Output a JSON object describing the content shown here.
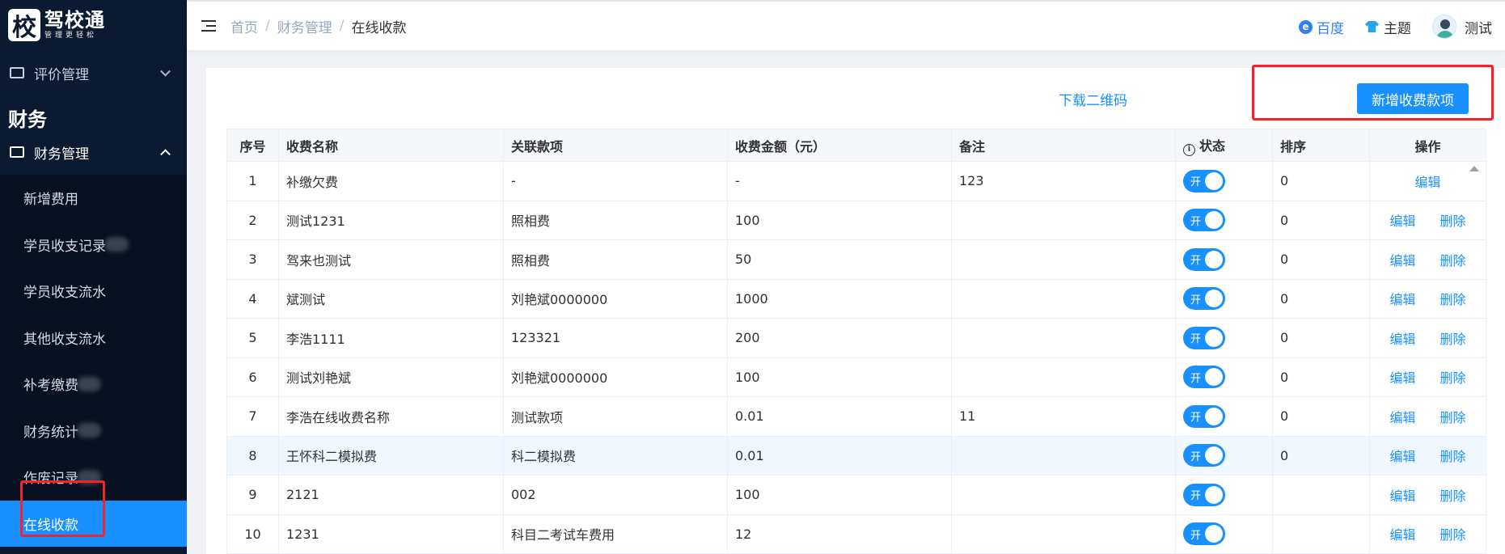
{
  "logo": {
    "mark": "校",
    "name": "驾校通",
    "slogan": "管理更轻松"
  },
  "sidebar": {
    "review_label": "评价管理",
    "section_title": "财务",
    "finance_label": "财务管理",
    "items": [
      {
        "label": "新增费用"
      },
      {
        "label": "学员收支记录"
      },
      {
        "label": "学员收支流水"
      },
      {
        "label": "其他收支流水"
      },
      {
        "label": "补考缴费"
      },
      {
        "label": "财务统计"
      },
      {
        "label": "作废记录"
      },
      {
        "label": "在线收款"
      }
    ]
  },
  "breadcrumb": {
    "home": "首页",
    "parent": "财务管理",
    "current": "在线收款",
    "sep": "/"
  },
  "header": {
    "baidu_icon": "e",
    "baidu": "百度",
    "theme": "主题",
    "user": "测试"
  },
  "actions": {
    "download_qr": "下载二维码",
    "add_item": "新增收费款项"
  },
  "table": {
    "columns": [
      "序号",
      "收费名称",
      "关联款项",
      "收费金额（元）",
      "备注",
      "状态",
      "排序",
      "操作"
    ],
    "status_info_icon": "i",
    "switch_label": "开",
    "edit_label": "编辑",
    "delete_label": "删除",
    "rows": [
      {
        "no": "1",
        "name": "补缴欠费",
        "linked": "-",
        "amount": "-",
        "remark": "123",
        "sort": "0"
      },
      {
        "no": "2",
        "name": "测试1231",
        "linked": "照相费",
        "amount": "100",
        "remark": "",
        "sort": "0"
      },
      {
        "no": "3",
        "name": "驾来也测试",
        "linked": "照相费",
        "amount": "50",
        "remark": "",
        "sort": "0"
      },
      {
        "no": "4",
        "name": "斌测试",
        "linked": "刘艳斌0000000",
        "amount": "1000",
        "remark": "",
        "sort": "0"
      },
      {
        "no": "5",
        "name": "李浩1111",
        "linked": "123321",
        "amount": "200",
        "remark": "",
        "sort": "0"
      },
      {
        "no": "6",
        "name": "测试刘艳斌",
        "linked": "刘艳斌0000000",
        "amount": "100",
        "remark": "",
        "sort": "0"
      },
      {
        "no": "7",
        "name": "李浩在线收费名称",
        "linked": "测试款项",
        "amount": "0.01",
        "remark": "11",
        "sort": "0"
      },
      {
        "no": "8",
        "name": "王怀科二模拟费",
        "linked": "科二模拟费",
        "amount": "0.01",
        "remark": "",
        "sort": "0"
      },
      {
        "no": "9",
        "name": "2121",
        "linked": "002",
        "amount": "100",
        "remark": "",
        "sort": ""
      },
      {
        "no": "10",
        "name": "1231",
        "linked": "科目二考试车费用",
        "amount": "12",
        "remark": "",
        "sort": ""
      }
    ]
  }
}
